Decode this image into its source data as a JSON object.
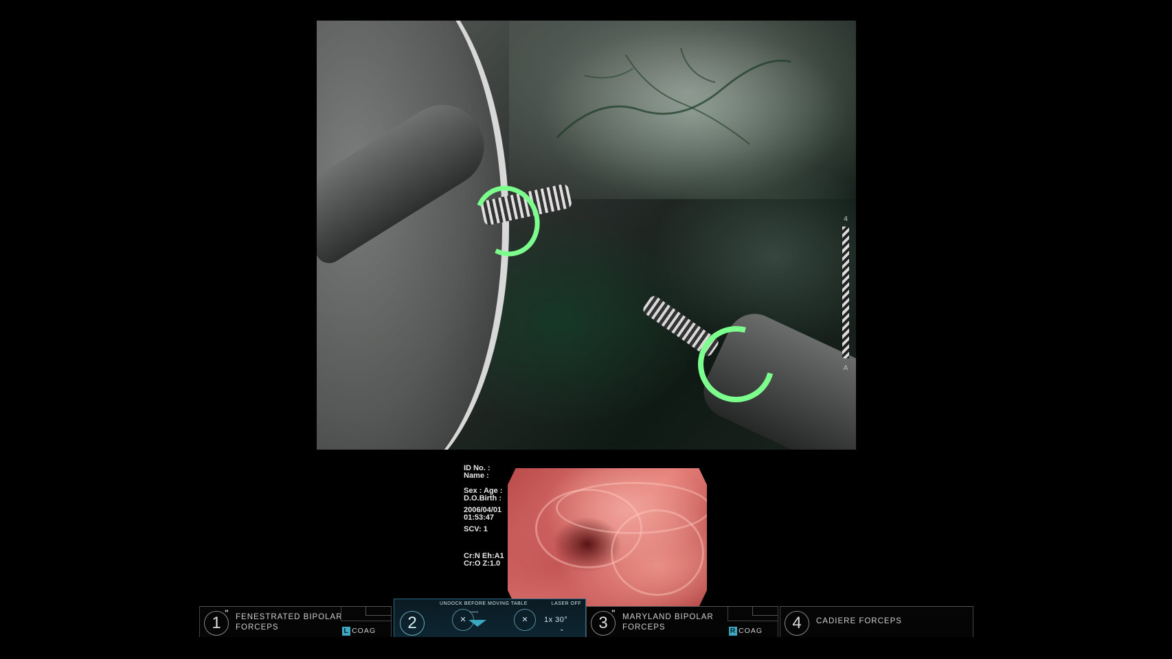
{
  "main_view": {
    "scale_top": "4",
    "scale_bottom": "A"
  },
  "patient_info": {
    "id_label": "ID  No. :",
    "name_label": "Name :",
    "sex_age_label": "Sex : Age :",
    "dob_label": "D.O.Birth :",
    "date": "2006/04/01",
    "time": "01:53:47",
    "scv": "SCV: 1",
    "line1": "Cr:N Eh:A1",
    "line2": "Cr:O Z:1.0"
  },
  "instrument_bar": {
    "slots": [
      {
        "number": "1",
        "marker": "\"",
        "name": "FENESTRATED BIPOLAR FORCEPS",
        "energy_letter": "L",
        "energy_label": "COAG"
      },
      {
        "number": "3",
        "marker": "\"",
        "name": "MARYLAND BIPOLAR FORCEPS",
        "energy_letter": "R",
        "energy_label": "COAG"
      },
      {
        "number": "4",
        "name": "CADIERE FORCEPS"
      }
    ],
    "camera": {
      "number": "2",
      "undock_text": "UNDOCK BEFORE MOVING TABLE",
      "laser_text": "LASER OFF",
      "zoom_text": "1x 30°",
      "faint_text": "•••••"
    }
  },
  "colors": {
    "instrument_highlight": "#7dff8e",
    "accent": "#3fa8c0"
  }
}
